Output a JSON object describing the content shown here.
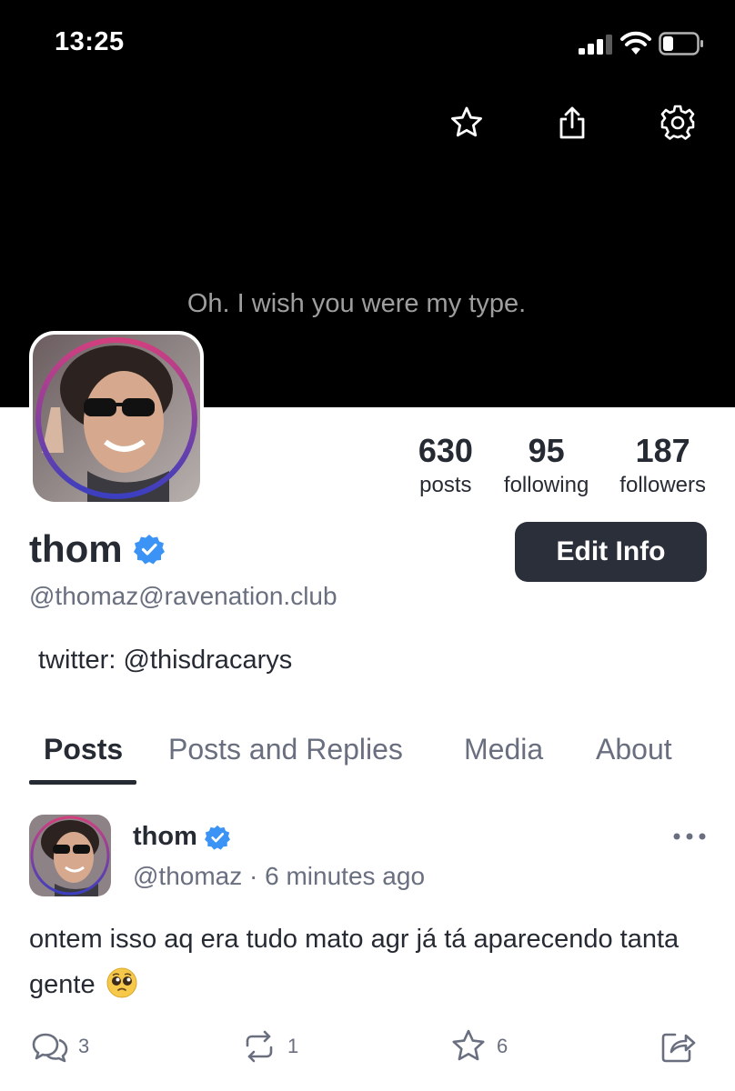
{
  "status_bar": {
    "time": "13:25"
  },
  "banner": {
    "caption": "Oh. I wish you were my type."
  },
  "stats": [
    {
      "value": "630",
      "label": "posts"
    },
    {
      "value": "95",
      "label": "following"
    },
    {
      "value": "187",
      "label": "followers"
    }
  ],
  "profile": {
    "name": "thom",
    "handle": "@thomaz@ravenation.club",
    "edit_label": "Edit Info",
    "bio": "twitter: @thisdracarys"
  },
  "tabs": [
    "Posts",
    "Posts and Replies",
    "Media",
    "About"
  ],
  "post": {
    "author": "thom",
    "meta": "@thomaz · 6 minutes ago",
    "text": "ontem isso aq era tudo mato agr já tá aparecendo tanta gente",
    "replies": "3",
    "boosts": "1",
    "favourites": "6"
  },
  "colors": {
    "text": "#262a33",
    "muted": "#6a6f80",
    "verified": "#3a93f5",
    "button": "#2b2f3a",
    "avatar_ring_top": "#d23f7e",
    "avatar_ring_bottom": "#3b3fbf"
  },
  "icons": [
    "star-icon",
    "share-icon",
    "gear-icon",
    "verified-icon",
    "more-icon",
    "reply-icon",
    "boost-icon",
    "favourite-icon",
    "send-icon"
  ]
}
